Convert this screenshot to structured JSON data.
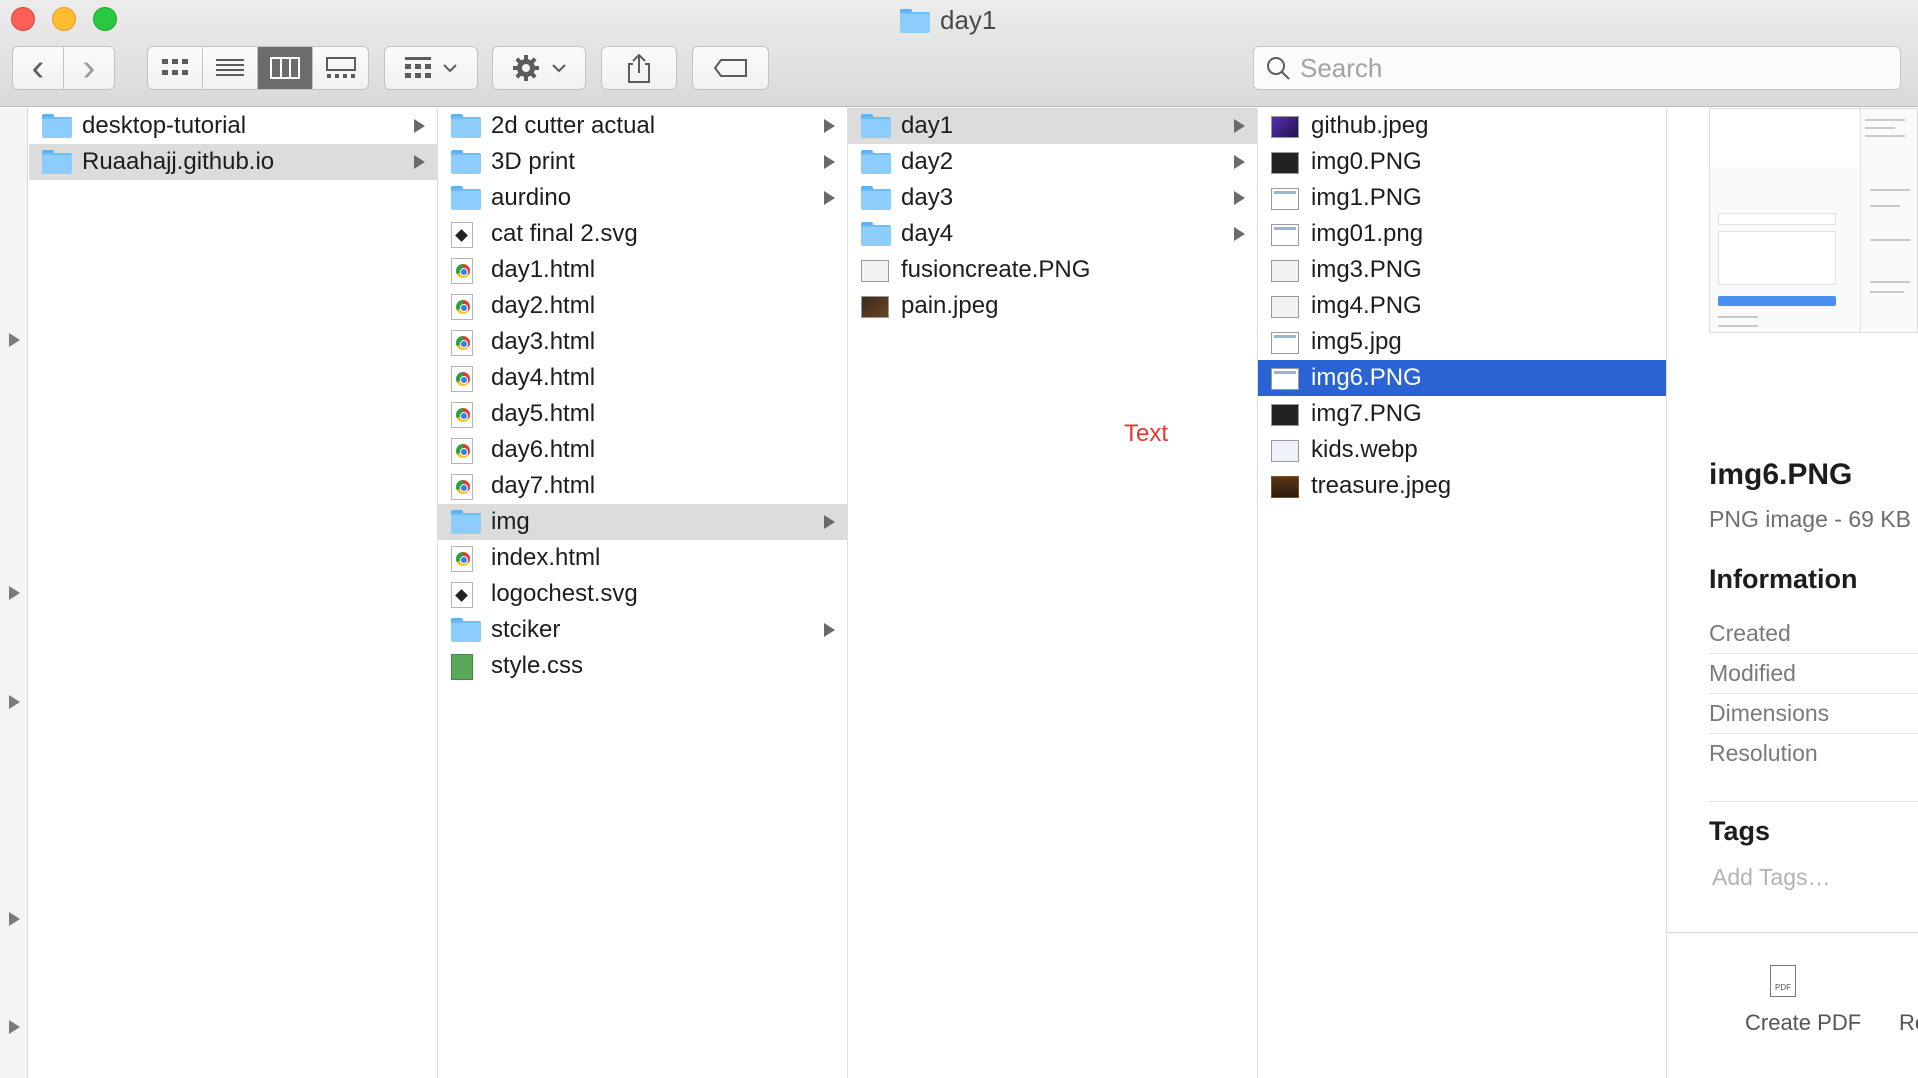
{
  "window": {
    "title": "day1"
  },
  "toolbar": {
    "back_glyph": "‹",
    "forward_glyph": "›"
  },
  "search": {
    "placeholder": "Search",
    "value": ""
  },
  "columns": {
    "col1": [
      {
        "name": "desktop-tutorial",
        "kind": "folder",
        "has_children": true,
        "state": ""
      },
      {
        "name": "Ruaahajj.github.io",
        "kind": "folder",
        "has_children": true,
        "state": "hl"
      }
    ],
    "col2": [
      {
        "name": "2d cutter actual",
        "kind": "folder",
        "has_children": true,
        "state": ""
      },
      {
        "name": "3D print",
        "kind": "folder",
        "has_children": true,
        "state": ""
      },
      {
        "name": "aurdino",
        "kind": "folder",
        "has_children": true,
        "state": ""
      },
      {
        "name": "cat final 2.svg",
        "kind": "svg",
        "has_children": false,
        "state": ""
      },
      {
        "name": "day1.html",
        "kind": "html",
        "has_children": false,
        "state": ""
      },
      {
        "name": "day2.html",
        "kind": "html",
        "has_children": false,
        "state": ""
      },
      {
        "name": "day3.html",
        "kind": "html",
        "has_children": false,
        "state": ""
      },
      {
        "name": "day4.html",
        "kind": "html",
        "has_children": false,
        "state": ""
      },
      {
        "name": "day5.html",
        "kind": "html",
        "has_children": false,
        "state": ""
      },
      {
        "name": "day6.html",
        "kind": "html",
        "has_children": false,
        "state": ""
      },
      {
        "name": "day7.html",
        "kind": "html",
        "has_children": false,
        "state": ""
      },
      {
        "name": "img",
        "kind": "folder",
        "has_children": true,
        "state": "hl"
      },
      {
        "name": "index.html",
        "kind": "html",
        "has_children": false,
        "state": ""
      },
      {
        "name": "logochest.svg",
        "kind": "svg",
        "has_children": false,
        "state": ""
      },
      {
        "name": "stciker",
        "kind": "folder",
        "has_children": true,
        "state": ""
      },
      {
        "name": "style.css",
        "kind": "css",
        "has_children": false,
        "state": ""
      }
    ],
    "col3": [
      {
        "name": "day1",
        "kind": "folder",
        "has_children": true,
        "state": "hl"
      },
      {
        "name": "day2",
        "kind": "folder",
        "has_children": true,
        "state": ""
      },
      {
        "name": "day3",
        "kind": "folder",
        "has_children": true,
        "state": ""
      },
      {
        "name": "day4",
        "kind": "folder",
        "has_children": true,
        "state": ""
      },
      {
        "name": "fusioncreate.PNG",
        "kind": "img-light",
        "has_children": false,
        "state": ""
      },
      {
        "name": "pain.jpeg",
        "kind": "img-photo",
        "has_children": false,
        "state": ""
      }
    ],
    "col4": [
      {
        "name": "github.jpeg",
        "kind": "img-purple",
        "has_children": false,
        "state": ""
      },
      {
        "name": "img0.PNG",
        "kind": "img-dark",
        "has_children": false,
        "state": ""
      },
      {
        "name": "img1.PNG",
        "kind": "img-screen",
        "has_children": false,
        "state": ""
      },
      {
        "name": "img01.png",
        "kind": "img-screen",
        "has_children": false,
        "state": ""
      },
      {
        "name": "img3.PNG",
        "kind": "img-light",
        "has_children": false,
        "state": ""
      },
      {
        "name": "img4.PNG",
        "kind": "img-light",
        "has_children": false,
        "state": ""
      },
      {
        "name": "img5.jpg",
        "kind": "img-screen",
        "has_children": false,
        "state": ""
      },
      {
        "name": "img6.PNG",
        "kind": "img-screen",
        "has_children": false,
        "state": "sel"
      },
      {
        "name": "img7.PNG",
        "kind": "img-dark",
        "has_children": false,
        "state": ""
      },
      {
        "name": "kids.webp",
        "kind": "img-web",
        "has_children": false,
        "state": ""
      },
      {
        "name": "treasure.jpeg",
        "kind": "img-chest",
        "has_children": false,
        "state": ""
      }
    ]
  },
  "annotation": {
    "text": "Text",
    "color": "#e23b2e"
  },
  "preview": {
    "name": "img6.PNG",
    "kind_size": "PNG image - 69 KB",
    "info_heading": "Information",
    "info_labels": [
      "Created",
      "Modified",
      "Dimensions",
      "Resolution"
    ],
    "tags_heading": "Tags",
    "tags_placeholder": "Add Tags…",
    "pdf_badge": "PDF",
    "actions": [
      "Create PDF",
      "Re"
    ]
  },
  "colors": {
    "selection": "#2a64d4",
    "highlight": "#dcdcdc",
    "folder": "#8ccdfb"
  }
}
